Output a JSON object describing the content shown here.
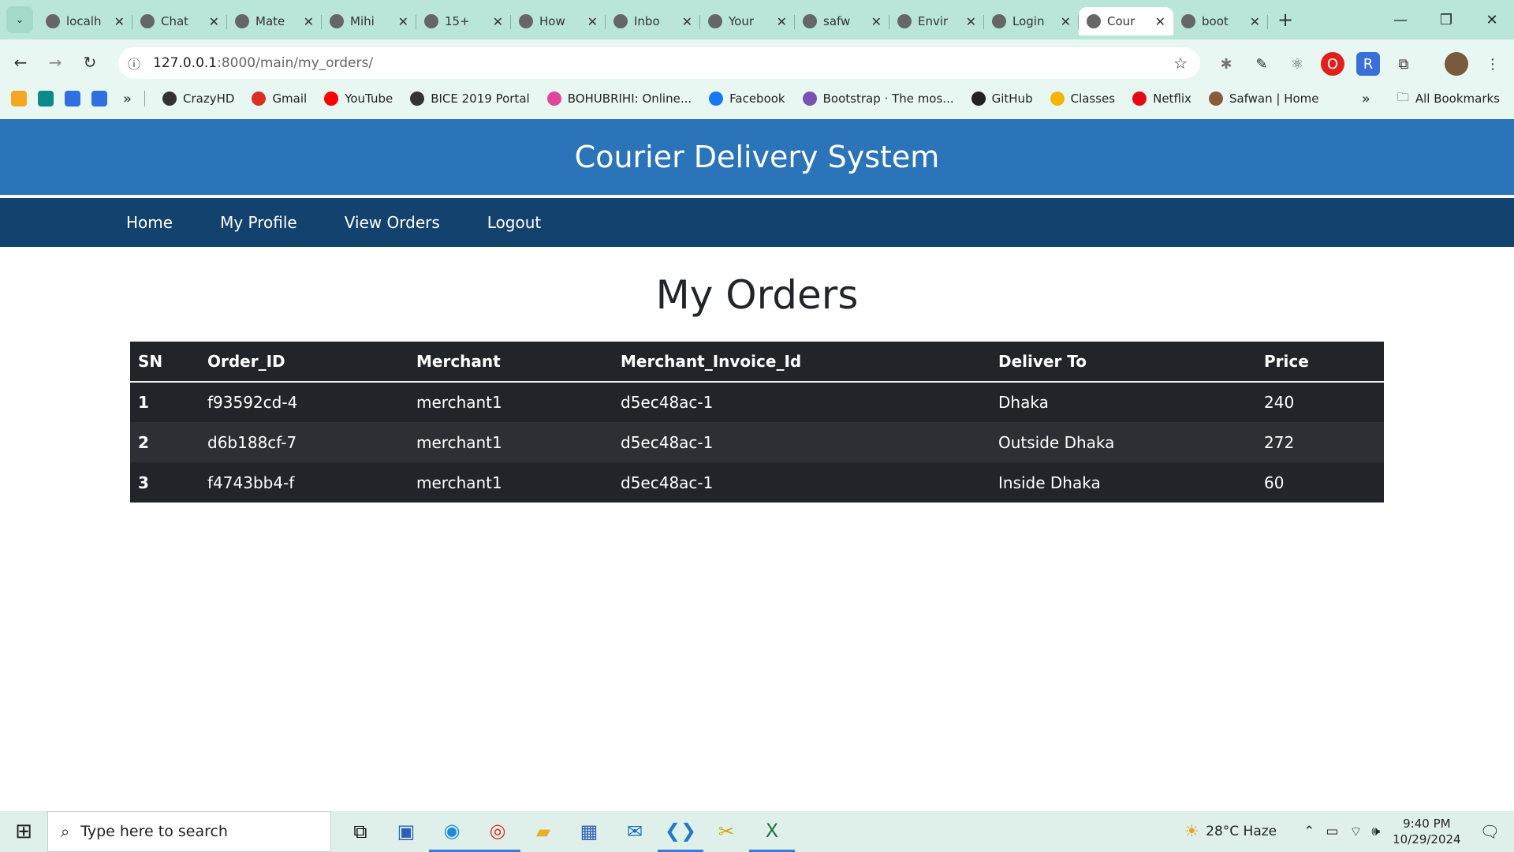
{
  "browser": {
    "tabs": [
      {
        "title": "localh",
        "icon": "globe-icon"
      },
      {
        "title": "Chat",
        "icon": "openai-icon"
      },
      {
        "title": "Mate",
        "icon": "material-icon"
      },
      {
        "title": "Mihi",
        "icon": "avatar-icon"
      },
      {
        "title": "15+",
        "icon": "person-icon"
      },
      {
        "title": "How",
        "icon": "doc-icon"
      },
      {
        "title": "Inbo",
        "icon": "gmail-icon"
      },
      {
        "title": "Your",
        "icon": "github-icon"
      },
      {
        "title": "safw",
        "icon": "github-icon"
      },
      {
        "title": "Envir",
        "icon": "diamond-icon"
      },
      {
        "title": "Login",
        "icon": "leaf-icon"
      },
      {
        "title": "Cour",
        "icon": "globe-icon",
        "active": true
      },
      {
        "title": "boot",
        "icon": "bootstrap-icon"
      }
    ],
    "url_host": "127.0.0.1",
    "url_path": ":8000/main/my_orders/",
    "bookmarks": [
      {
        "label": "CrazyHD",
        "color": "#333333"
      },
      {
        "label": "Gmail",
        "color": "#d93025"
      },
      {
        "label": "YouTube",
        "color": "#ff0000"
      },
      {
        "label": "BICE 2019 Portal",
        "color": "#333333"
      },
      {
        "label": "BOHUBRIHI: Online...",
        "color": "#e0459b"
      },
      {
        "label": "Facebook",
        "color": "#1877f2"
      },
      {
        "label": "Bootstrap · The mos...",
        "color": "#7952b3"
      },
      {
        "label": "GitHub",
        "color": "#222222"
      },
      {
        "label": "Classes",
        "color": "#f4b400"
      },
      {
        "label": "Netflix",
        "color": "#e50914"
      },
      {
        "label": "Safwan | Home",
        "color": "#8a5a3c"
      }
    ],
    "all_bookmarks": "All Bookmarks"
  },
  "site": {
    "title": "Courier Delivery System",
    "nav": [
      "Home",
      "My Profile",
      "View Orders",
      "Logout"
    ],
    "page_title": "My Orders"
  },
  "orders": {
    "headers": [
      "SN",
      "Order_ID",
      "Merchant",
      "Merchant_Invoice_Id",
      "Deliver To",
      "Price"
    ],
    "rows": [
      [
        "1",
        "f93592cd-4",
        "merchant1",
        "d5ec48ac-1",
        "Dhaka",
        "240"
      ],
      [
        "2",
        "d6b188cf-7",
        "merchant1",
        "d5ec48ac-1",
        "Outside Dhaka",
        "272"
      ],
      [
        "3",
        "f4743bb4-f",
        "merchant1",
        "d5ec48ac-1",
        "Inside Dhaka",
        "60"
      ]
    ]
  },
  "taskbar": {
    "search_placeholder": "Type here to search",
    "weather": "28°C  Haze",
    "time": "9:40 PM",
    "date": "10/29/2024"
  },
  "colors": {
    "header": "#2b74b9",
    "nav": "#13426e",
    "table_dark": "#212529"
  }
}
